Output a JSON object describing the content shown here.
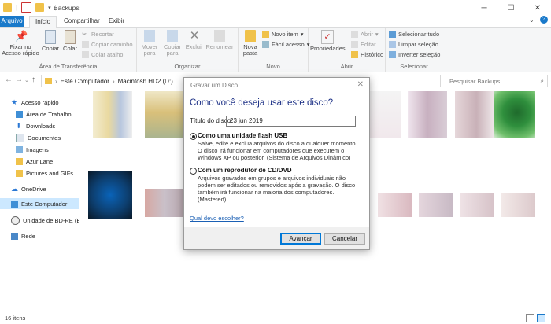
{
  "window": {
    "title": "Backups"
  },
  "tabs": [
    "Arquivo",
    "Início",
    "Compartilhar",
    "Exibir"
  ],
  "ribbon": {
    "clipboard": {
      "pin": "Fixar no Acesso rápido",
      "copy": "Copiar",
      "paste": "Colar",
      "cut": "Recortar",
      "copy_path": "Copiar caminho",
      "paste_shortcut": "Colar atalho",
      "label": "Área de Transferência"
    },
    "organize": {
      "move": "Mover para",
      "copy_to": "Copiar para",
      "delete": "Excluir",
      "rename": "Renomear",
      "label": "Organizar"
    },
    "new": {
      "new_folder": "Nova pasta",
      "new_item": "Novo item",
      "easy_access": "Fácil acesso",
      "label": "Novo"
    },
    "open": {
      "properties": "Propriedades",
      "open": "Abrir",
      "edit": "Editar",
      "history": "Histórico",
      "label": "Abrir"
    },
    "select": {
      "select_all": "Selecionar tudo",
      "select_none": "Limpar seleção",
      "invert": "Inverter seleção",
      "label": "Selecionar"
    }
  },
  "address": {
    "crumb1": "Este Computador",
    "crumb2": "Macintosh HD2 (D:)",
    "search_placeholder": "Pesquisar Backups"
  },
  "sidebar": {
    "quick_access": "Acesso rápido",
    "items": [
      "Área de Trabalho",
      "Downloads",
      "Documentos",
      "Imagens",
      "Azur Lane",
      "Pictures and GIFs"
    ],
    "onedrive": "OneDrive",
    "this_pc": "Este Computador",
    "bd_drive": "Unidade de BD-RE (E:",
    "network": "Rede"
  },
  "status": {
    "count": "16 itens"
  },
  "dialog": {
    "title": "Gravar um Disco",
    "heading": "Como você deseja usar este disco?",
    "disc_title_label": "Título do disco:",
    "disc_title_value": "23 jun 2019",
    "option1_title": "Como uma unidade flash USB",
    "option1_desc": "Salve, edite e exclua arquivos do disco a qualquer momento. O disco irá funcionar em computadores que executem o Windows XP ou posterior. (Sistema de Arquivos Dinâmico)",
    "option2_title": "Com um reprodutor de CD/DVD",
    "option2_desc": "Arquivos gravados em grupos e arquivos individuais não podem ser editados ou removidos após a gravação. O disco também irá funcionar na maioria dos computadores. (Mastered)",
    "help_link": "Qual devo escolher?",
    "next_button": "Avançar",
    "cancel_button": "Cancelar",
    "selected_option": 1
  },
  "colors": {
    "accent": "#1979ca",
    "heading": "#1e3287",
    "selection": "#cce8ff"
  }
}
